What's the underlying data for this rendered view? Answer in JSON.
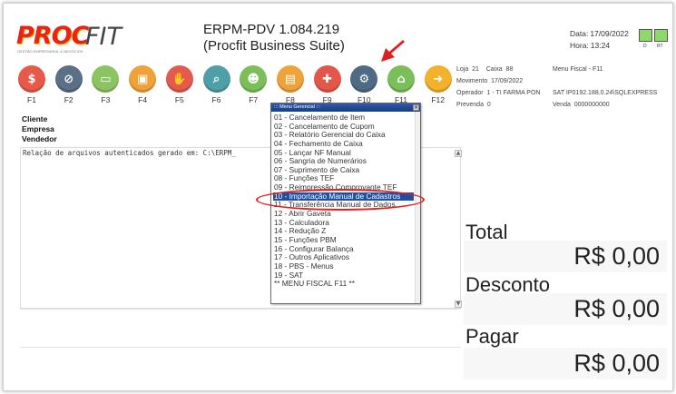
{
  "header": {
    "logo_text_a": "PROC",
    "logo_text_b": "FIT",
    "logo_tagline": "GESTÃO EMPRESARIAL & NEGÓCIOS",
    "title_line1": "ERPM-PDV 1.084.219",
    "title_line2": "(Procfit Business Suite)",
    "date_label": "Data:",
    "date_value": "17/09/2022",
    "time_label": "Hora:",
    "time_value": "13:24",
    "indicator_labels": [
      "D",
      "RT"
    ]
  },
  "function_keys": [
    {
      "label": "F1",
      "icon": "money-icon",
      "color": "#e8594a"
    },
    {
      "label": "F2",
      "icon": "cancel-card-icon",
      "color": "#5b6f86"
    },
    {
      "label": "F3",
      "icon": "card-icon",
      "color": "#8cc464"
    },
    {
      "label": "F4",
      "icon": "id-card-icon",
      "color": "#f0a23a"
    },
    {
      "label": "F5",
      "icon": "hand-icon",
      "color": "#e45a4c"
    },
    {
      "label": "F6",
      "icon": "search-icon",
      "color": "#4e9fa7"
    },
    {
      "label": "F7",
      "icon": "users-icon",
      "color": "#7bbf5a"
    },
    {
      "label": "F8",
      "icon": "calculator-icon",
      "color": "#f0a23a"
    },
    {
      "label": "F9",
      "icon": "health-icon",
      "color": "#e3574a"
    },
    {
      "label": "F10",
      "icon": "gear-icon",
      "color": "#4f6a85"
    },
    {
      "label": "F11",
      "icon": "bank-icon",
      "color": "#7bbf5a"
    },
    {
      "label": "F12",
      "icon": "arrow-right-icon",
      "color": "#f4b12e"
    }
  ],
  "info": {
    "loja_label": "Loja",
    "loja_value": "21",
    "caixa_label": "Caixa",
    "caixa_value": "88",
    "menu_fiscal": "Menu Fiscal - F11",
    "movimento_label": "Movimento",
    "movimento_value": "17/09/2022",
    "operador_label": "Operador",
    "operador_value": "1 - TI FARMA PON",
    "sat_label": "SAT IP",
    "sat_value": "0192.188.0.24\\SQLEXPRESS",
    "prevenda_label": "Prevenda",
    "prevenda_value": "0",
    "venda_label": "Venda",
    "venda_value": "0000000000"
  },
  "client": {
    "cliente": "Cliente",
    "empresa": "Empresa",
    "vendedor": "Vendedor"
  },
  "log_text": "Relação de arquivos autenticados gerado em: C:\\ERPM_",
  "totals": {
    "total_label": "Total",
    "total_value": "R$ 0,00",
    "desconto_label": "Desconto",
    "desconto_value": "R$ 0,00",
    "pagar_label": "Pagar",
    "pagar_value": "R$ 0,00"
  },
  "menu": {
    "title": "::: Menu Gerencial :::",
    "close": "×",
    "items": [
      "01 - Cancelamento de Item",
      "02 - Cancelamento de Cupom",
      "03 - Relatório Gerencial do Caixa",
      "04 - Fechamento de Caixa",
      "05 - Lançar NF Manual",
      "06 - Sangria de Numerários",
      "07 - Suprimento de Caixa",
      "08 - Funções TEF",
      "09 - Reimpressão Comprovante TEF",
      "10 - Importação Manual de Cadastros",
      "11 - Transferência Manual de Dados",
      "12 - Abrir Gaveta",
      "13 - Calculadora",
      "14 - Redução Z",
      "15 - Funções PBM",
      "16 - Configurar Balança",
      "17 - Outros Aplicativos",
      "18 - PBS - Menus",
      "19 - SAT",
      "** MENU FISCAL F11 **"
    ],
    "selected_index": 9
  },
  "colors": {
    "selection": "#1d4fa3",
    "annotation": "#e02020",
    "led": "#8fd86a"
  }
}
